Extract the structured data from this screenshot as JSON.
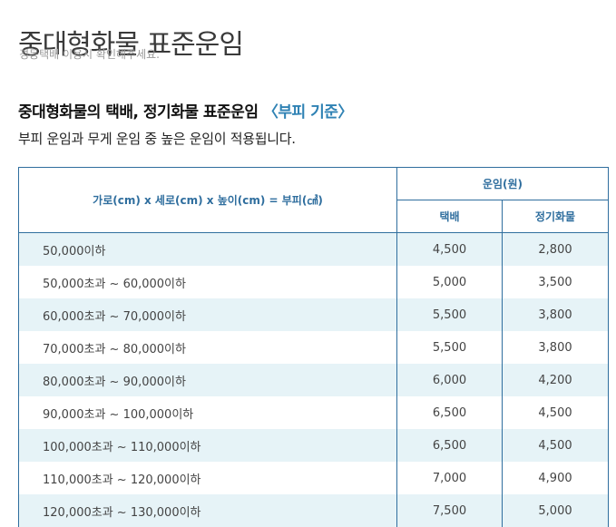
{
  "page": {
    "title": "중대형화물 표준운임",
    "subtitle": "경동택배 이용시 확인해주세요."
  },
  "section": {
    "heading_main": "중대형화물의 택배, 정기화물 표준운임 ",
    "heading_accent": "〈부피 기준〉",
    "description": "부피 운임과 무게 운임 중 높은 운임이 적용됩니다."
  },
  "table": {
    "size_header": "가로(cm) x 세로(cm) x 높이(cm) = 부피(㎤)",
    "rate_header": "운임(원)",
    "col_parcel": "택배",
    "col_regular": "정기화물",
    "rows": [
      {
        "size": "50,000이하",
        "parcel": "4,500",
        "regular": "2,800"
      },
      {
        "size": "50,000초과 ~ 60,000이하",
        "parcel": "5,000",
        "regular": "3,500"
      },
      {
        "size": "60,000초과 ~ 70,000이하",
        "parcel": "5,500",
        "regular": "3,800"
      },
      {
        "size": "70,000초과 ~ 80,000이하",
        "parcel": "5,500",
        "regular": "3,800"
      },
      {
        "size": "80,000초과 ~ 90,000이하",
        "parcel": "6,000",
        "regular": "4,200"
      },
      {
        "size": "90,000초과 ~ 100,000이하",
        "parcel": "6,500",
        "regular": "4,500"
      },
      {
        "size": "100,000초과 ~ 110,000이하",
        "parcel": "6,500",
        "regular": "4,500"
      },
      {
        "size": "110,000초과 ~ 120,000이하",
        "parcel": "7,000",
        "regular": "4,900"
      },
      {
        "size": "120,000초과 ~ 130,000이하",
        "parcel": "7,500",
        "regular": "5,000"
      }
    ]
  }
}
